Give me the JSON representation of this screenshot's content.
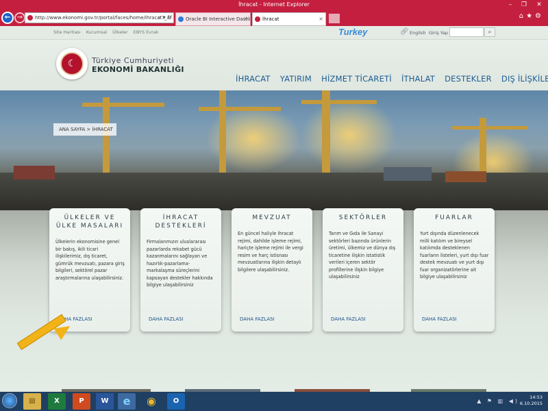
{
  "browser": {
    "window_title": "İhracat - Internet Explorer",
    "address": "http://www.ekonomi.gov.tr/portal/faces/home/ihracat?_af",
    "address_tools": "⌕ ▾ ↻",
    "tabs": [
      {
        "label": "Oracle BI Interactive Dashboar...",
        "close": "×"
      },
      {
        "label": "İhracat",
        "close": "×"
      }
    ],
    "back_glyph": "←",
    "forward_glyph": "→",
    "toolbar_icons": "⌂★⚙",
    "window_buttons": {
      "minimize": "–",
      "restore": "❐",
      "close": "✕"
    }
  },
  "site": {
    "top_links": [
      "Site Haritası",
      "Kurumsal",
      "Ülkeler",
      "EBYS Evrak"
    ],
    "turkey_brand": "Turkey",
    "lang_link": "English",
    "login_link": "Giriş Yap",
    "search_placeholder": "",
    "org_line1": "Türkiye Cumhuriyeti",
    "org_line2": "EKONOMİ BAKANLIĞI",
    "main_nav": [
      "İHRACAT",
      "YATIRIM",
      "HİZMET TİCARETİ",
      "İTHALAT",
      "DESTEKLER",
      "DIŞ İLİŞKİLER"
    ],
    "breadcrumb": "ANA SAYFA  >  İHRACAT"
  },
  "cards": [
    {
      "title_line1": "ÜLKELER VE",
      "title_line2": "ÜLKE MASALARI",
      "body": "Ülkelerin ekonomisine genel bir bakış, ikili ticari ilişkilerimiz, dış ticaret, gümrük mevzuatı, pazara giriş bilgileri, sektörel pazar araştırmalarına ulaşabilirsiniz.",
      "more": "DAHA FAZLASI"
    },
    {
      "title_line1": "İHRACAT",
      "title_line2": "DESTEKLERİ",
      "body": "Firmalarımızın uluslararası pazarlarda rekabet gücü kazanmalarını sağlayan ve hazırlık-pazarlama-markalaşma süreçlerini kapsayan destekler hakkında bilgiye ulaşabilirsiniz",
      "more": "DAHA FAZLASI"
    },
    {
      "title_line1": "MEVZUAT",
      "title_line2": "",
      "body": "En güncel haliyle ihracat rejimi, dahilde işleme rejimi, hariçte işleme rejimi ile vergi resim ve harç istisnası mevzuatlarına ilişkin detaylı bilgilere ulaşabilirsiniz.",
      "more": "DAHA FAZLASI"
    },
    {
      "title_line1": "SEKTÖRLER",
      "title_line2": "",
      "body": "Tarım ve Gıda ile Sanayi sektörleri bazında ürünlerin üretimi, ülkemiz ve dünya dış ticaretine ilişkin istatistik verileri içeren sektör profillerine ilişkin bilgiye ulaşabilirsiniz",
      "more": "DAHA FAZLASI"
    },
    {
      "title_line1": "FUARLAR",
      "title_line2": "",
      "body": "Yurt dışında düzenlenecek milli katılım ve bireysel katılımda desteklenen fuarların listeleri, yurt dışı fuar destek mevzuatı ve yurt dışı fuar organizatörlerine ait bilgiye ulaşabilirsiniz",
      "more": "DAHA FAZLASI"
    }
  ],
  "taskbar": {
    "apps": [
      {
        "name": "file-explorer",
        "glyph": "▤"
      },
      {
        "name": "excel",
        "glyph": "X"
      },
      {
        "name": "powerpoint",
        "glyph": "P"
      },
      {
        "name": "word",
        "glyph": "W"
      },
      {
        "name": "internet-explorer",
        "glyph": "e"
      },
      {
        "name": "chrome",
        "glyph": "◉"
      },
      {
        "name": "outlook",
        "glyph": "O"
      }
    ],
    "tray": "▲ ⚑ ▥ ◀)",
    "time": "14:53",
    "date": "6.10.2015"
  },
  "colors": {
    "ie_chrome": "#c41f3f",
    "nav_link": "#1c5c93",
    "arrow": "#f2b318",
    "taskbar": "#1f3f63"
  }
}
